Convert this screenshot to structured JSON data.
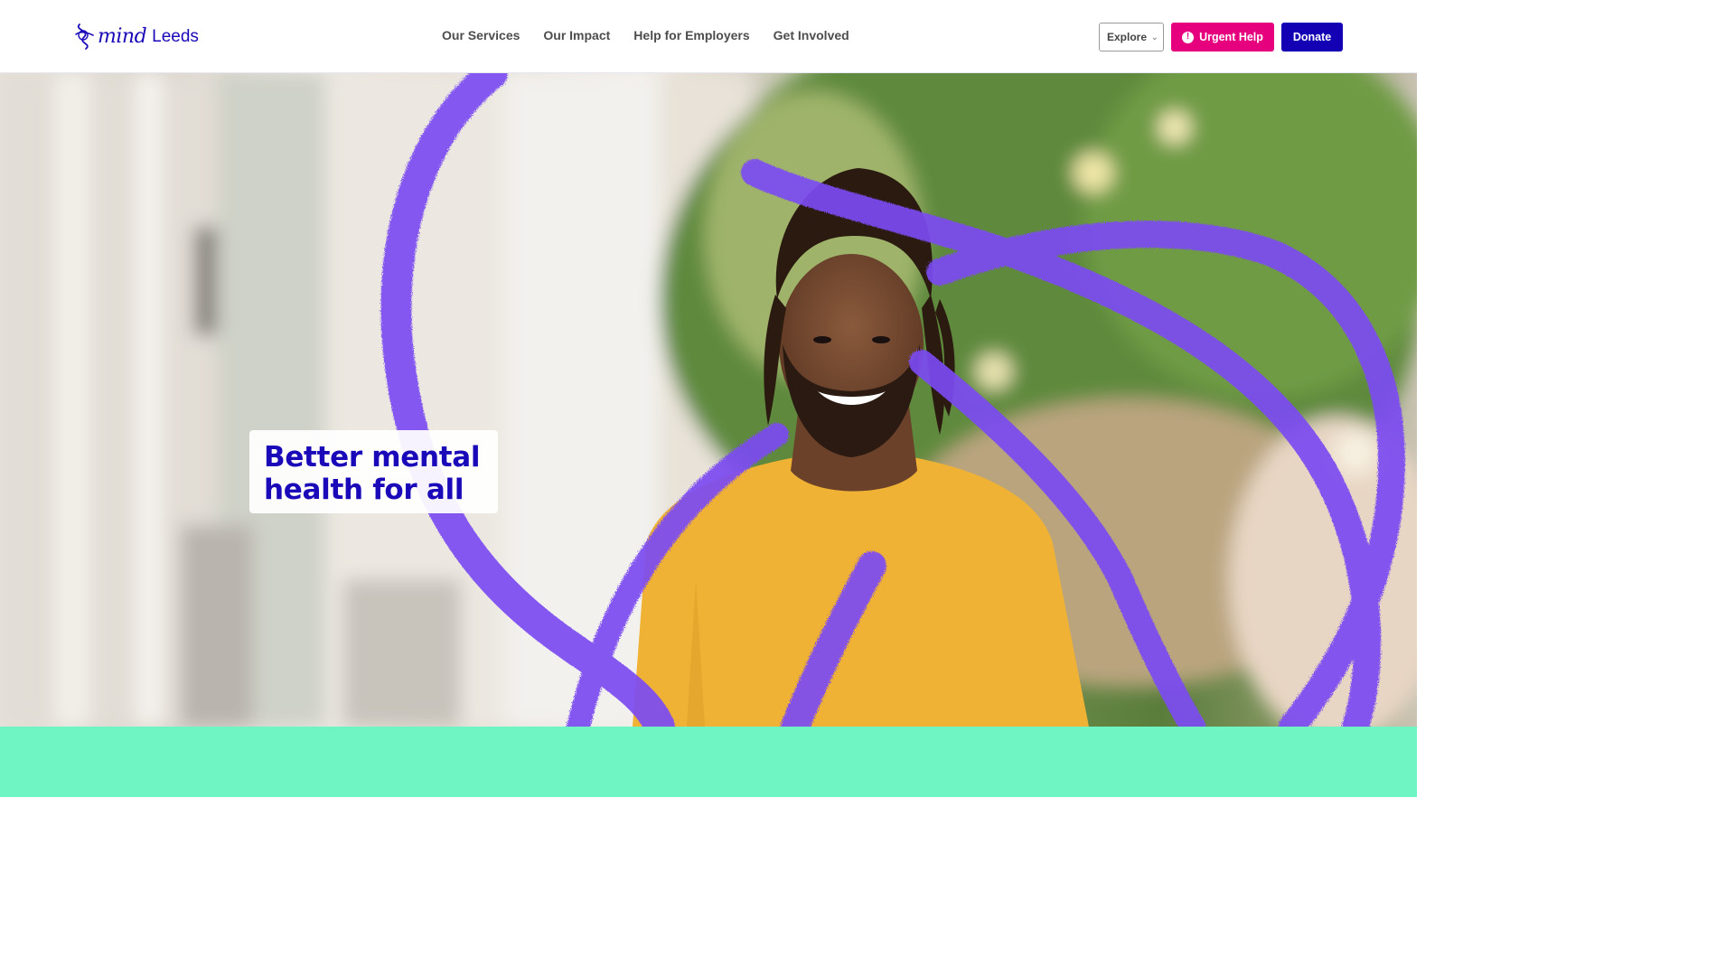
{
  "header": {
    "logo": {
      "brand": "mind",
      "location": "Leeds"
    },
    "nav": [
      {
        "label": "Our Services"
      },
      {
        "label": "Our Impact"
      },
      {
        "label": "Help for Employers"
      },
      {
        "label": "Get Involved"
      }
    ],
    "explore": {
      "label": "Explore"
    },
    "urgent_help": {
      "label": "Urgent Help",
      "icon": "alert-icon"
    },
    "donate": {
      "label": "Donate"
    }
  },
  "hero": {
    "headline_line1": "Better mental",
    "headline_line2": "health for all",
    "image_description_icon": "smiling-man-photo"
  },
  "colors": {
    "brand_blue": "#1a09b8",
    "urgent_pink": "#e6007e",
    "donate_blue": "#1300b5",
    "scribble_purple": "#7b4cf2",
    "mint_band": "#6ff5c4"
  }
}
